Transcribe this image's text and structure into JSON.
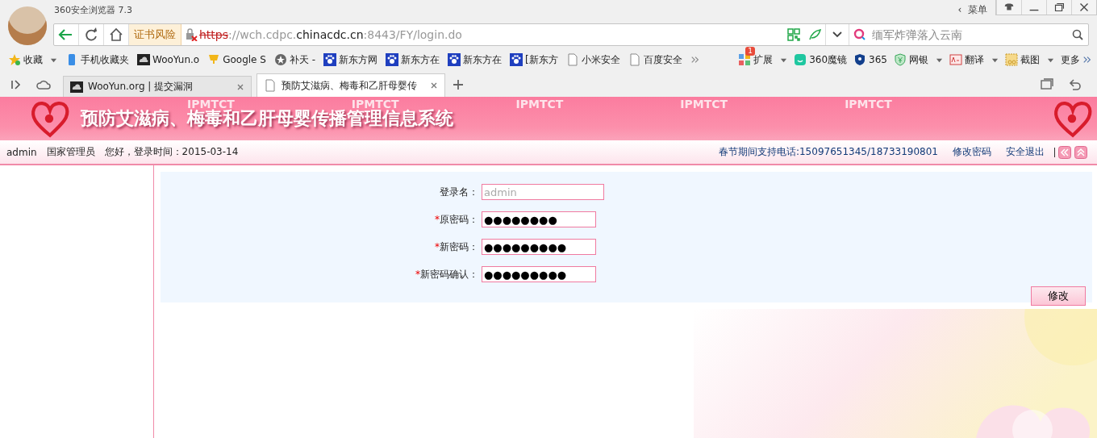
{
  "window": {
    "title": "360安全浏览器 7.3",
    "menu_arrow": "‹",
    "menu": "菜单"
  },
  "toolbar": {
    "cert_warning": "证书风险",
    "url_scheme": "https",
    "url_host_pre": "://wch.cdpc.",
    "url_host": "chinacdc.cn",
    "url_rest": ":8443/FY/login.do",
    "search": {
      "placeholder": "缅军炸弹落入云南"
    }
  },
  "bookmarks": [
    {
      "label": "收藏",
      "kind": "star",
      "dropdown": true
    },
    {
      "label": "手机收藏夹",
      "kind": "phone",
      "dropdown": false
    },
    {
      "label": "WooYun.o",
      "kind": "cloud",
      "dropdown": false
    },
    {
      "label": "Google S",
      "kind": "cup",
      "dropdown": false
    },
    {
      "label": "补天 -",
      "kind": "badge",
      "dropdown": false
    },
    {
      "label": "新东方网",
      "kind": "paw",
      "dropdown": false
    },
    {
      "label": "新东方在",
      "kind": "paw",
      "dropdown": false
    },
    {
      "label": "新东方在",
      "kind": "paw",
      "dropdown": false
    },
    {
      "label": "[新东方",
      "kind": "paw",
      "dropdown": false
    },
    {
      "label": "小米安全",
      "kind": "page",
      "dropdown": false
    },
    {
      "label": "百度安全",
      "kind": "page",
      "dropdown": false
    }
  ],
  "extensions": [
    {
      "label": "扩展",
      "kind": "grid",
      "badge": "1",
      "dropdown": true
    },
    {
      "label": "360魔镜",
      "kind": "smile",
      "dropdown": false
    },
    {
      "label": "365",
      "kind": "shield",
      "dropdown": false
    },
    {
      "label": "网银",
      "kind": "yen",
      "dropdown": true
    },
    {
      "label": "翻译",
      "kind": "translate",
      "dropdown": true
    },
    {
      "label": "截图",
      "kind": "scissors",
      "dropdown": true
    },
    {
      "label": "更多",
      "kind": "more",
      "dropdown": false
    }
  ],
  "tabs": [
    {
      "label": "WooYun.org | 提交漏洞",
      "selected": false,
      "kind": "cloud"
    },
    {
      "label": "预防艾滋病、梅毒和乙肝母婴传",
      "selected": true,
      "kind": "page"
    }
  ],
  "banner": {
    "title": "预防艾滋病、梅毒和乙肝母婴传播管理信息系统",
    "marks_top": [
      "IPMTCT",
      "IPMTCT",
      "IPMTCT",
      "IPMTCT",
      "IPMTCT"
    ]
  },
  "userbar": {
    "user": "admin",
    "role": "国家管理员",
    "greeting": "您好，登录时间：2015-03-14",
    "support": "春节期间支持电话:15097651345/18733190801",
    "links": [
      "修改密码",
      "安全退出"
    ]
  },
  "form": {
    "fields": [
      {
        "label": "登录名：",
        "required": false,
        "value": "admin",
        "disabled": true
      },
      {
        "label": "原密码：",
        "required": true,
        "value": "●●●●●●●●",
        "disabled": false
      },
      {
        "label": "新密码：",
        "required": true,
        "value": "●●●●●●●●●",
        "disabled": false
      },
      {
        "label": "新密码确认：",
        "required": true,
        "value": "●●●●●●●●●",
        "disabled": false
      }
    ],
    "required_mark": "*",
    "submit": "修改"
  }
}
